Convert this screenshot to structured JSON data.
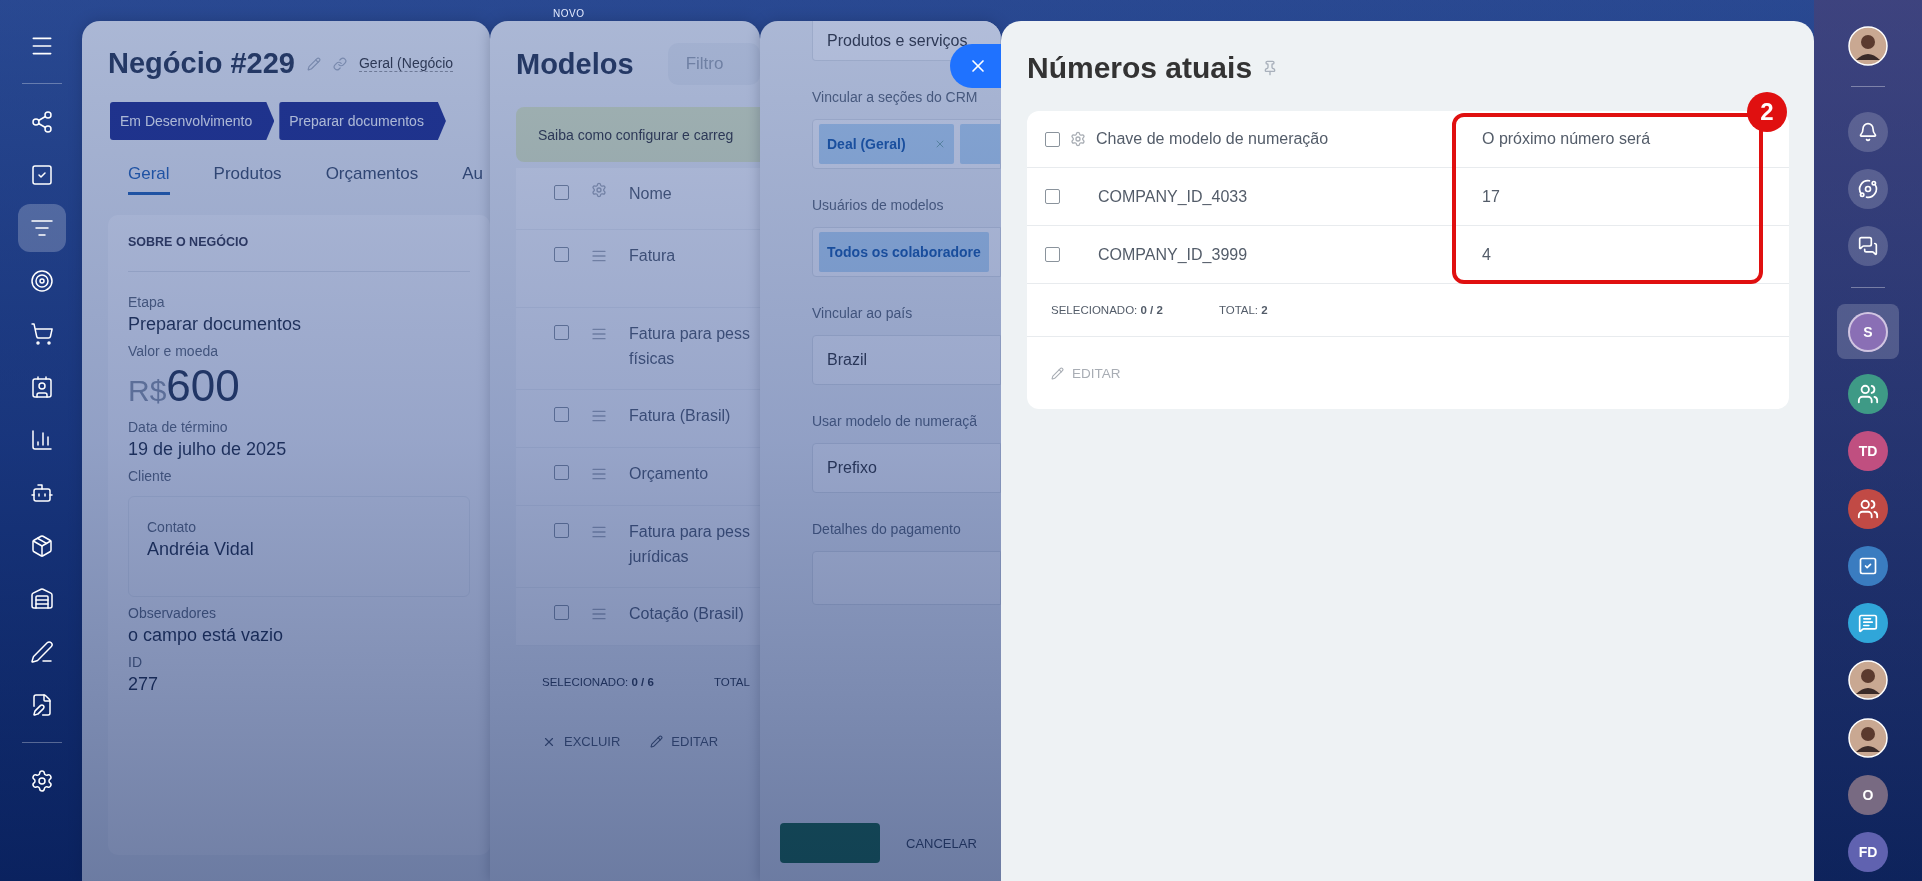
{
  "left_nav": {
    "items": [
      {
        "selected": false
      },
      {
        "selected": false
      },
      {
        "selected": true
      },
      {
        "selected": false
      },
      {
        "selected": false
      },
      {
        "selected": false
      },
      {
        "selected": false
      },
      {
        "selected": false
      },
      {
        "selected": false
      },
      {
        "selected": false
      },
      {
        "selected": false
      },
      {
        "selected": false
      },
      {
        "selected": false
      }
    ]
  },
  "top_bar": {
    "badge": "NOVO"
  },
  "deal_panel": {
    "title": "Negócio #229",
    "category": "Geral (Negócio",
    "stages": [
      "Em Desenvolvimento",
      "Preparar documentos"
    ],
    "tabs": [
      {
        "label": "Geral",
        "selected": true
      },
      {
        "label": "Produtos",
        "selected": false
      },
      {
        "label": "Orçamentos",
        "selected": false
      },
      {
        "label": "Au",
        "selected": false
      }
    ],
    "section_title": "SOBRE O NEGÓCIO",
    "fields": [
      {
        "kind": "text",
        "label": "Etapa",
        "value": "Preparar documentos"
      },
      {
        "kind": "money",
        "label": "Valor e moeda",
        "currency": "R$",
        "value": "600"
      },
      {
        "kind": "text",
        "label": "Data de término",
        "value": "19 de julho de 2025"
      },
      {
        "kind": "contact",
        "label": "Cliente",
        "sublabel": "Contato",
        "value": "Andréia Vidal"
      },
      {
        "kind": "text",
        "label": "Observadores",
        "value": "o campo está vazio"
      },
      {
        "kind": "text",
        "label": "ID",
        "value": "277"
      }
    ]
  },
  "models_panel": {
    "title": "Modelos",
    "filter_placeholder": "Filtro",
    "notice": "Saiba como configurar e carreg",
    "header": {
      "label": "Nome",
      "checked": false
    },
    "rows": [
      {
        "lines": [
          "Fatura"
        ],
        "checked": false
      },
      {
        "lines": [
          "Fatura para pess",
          "físicas"
        ],
        "checked": false
      },
      {
        "lines": [
          "Fatura (Brasil)"
        ],
        "checked": false
      },
      {
        "lines": [
          "Orçamento"
        ],
        "checked": false
      },
      {
        "lines": [
          "Fatura para pess",
          "jurídicas"
        ],
        "checked": false
      },
      {
        "lines": [
          "Cotação (Brasil)"
        ],
        "checked": false
      }
    ],
    "footer": {
      "selected_label": "SELECIONADO:",
      "selected_value": "0 / 6",
      "total_label": "TOTAL"
    },
    "actions": [
      "EXCLUIR",
      "EDITAR"
    ]
  },
  "settings_panel": {
    "top_value": "Produtos e serviços",
    "fields": [
      {
        "kind": "tags",
        "label": "Vincular a seções do CRM",
        "tags": [
          "Deal (Geral)"
        ],
        "more_tag": true
      },
      {
        "kind": "tags",
        "label": "Usuários de modelos",
        "tags": [
          "Todos os colaboradore"
        ],
        "more_tag": false
      },
      {
        "kind": "select",
        "label": "Vincular ao país",
        "value": "Brazil"
      },
      {
        "kind": "select",
        "label": "Usar modelo de numeraçã",
        "value": "Prefixo"
      },
      {
        "kind": "textarea",
        "label": "Detalhes do pagamento"
      }
    ],
    "cancel": "CANCELAR"
  },
  "numbers_panel": {
    "title": "Números atuais",
    "columns": [
      "Chave de modelo de numeração",
      "O próximo número será"
    ],
    "header_checked": false,
    "rows": [
      {
        "cells": [
          "COMPANY_ID_4033",
          "17"
        ],
        "checked": false
      },
      {
        "cells": [
          "COMPANY_ID_3999",
          "4"
        ],
        "checked": false
      }
    ],
    "footer": {
      "selected_label": "SELECIONADO:",
      "selected_value": "0 / 2",
      "total_label": "TOTAL:",
      "total_value": "2"
    },
    "action": {
      "label": "EDITAR",
      "disabled": true
    },
    "highlight": {
      "badge": "2"
    }
  },
  "right_bar": {
    "items": [
      {
        "kind": "photo",
        "selected": false
      },
      {
        "kind": "bell",
        "selected": false
      },
      {
        "kind": "copilot",
        "selected": false
      },
      {
        "kind": "chat-swap",
        "selected": false
      },
      {
        "kind": "initials",
        "label": "S",
        "color": "#8a6fb5",
        "selected": true
      },
      {
        "kind": "group",
        "color": "#3e9a86",
        "selected": false
      },
      {
        "kind": "initials",
        "label": "TD",
        "color": "#c04f80",
        "selected": false
      },
      {
        "kind": "group",
        "color": "#c14a45",
        "selected": false
      },
      {
        "kind": "task",
        "color": "#3a7cc0",
        "selected": false
      },
      {
        "kind": "chat",
        "color": "#30a6d9",
        "selected": false
      },
      {
        "kind": "photo",
        "selected": false
      },
      {
        "kind": "photo",
        "selected": false
      },
      {
        "kind": "initials",
        "label": "O",
        "color": "#786a82",
        "selected": false
      },
      {
        "kind": "initials",
        "label": "FD",
        "color": "#6062b0",
        "selected": false
      }
    ]
  }
}
